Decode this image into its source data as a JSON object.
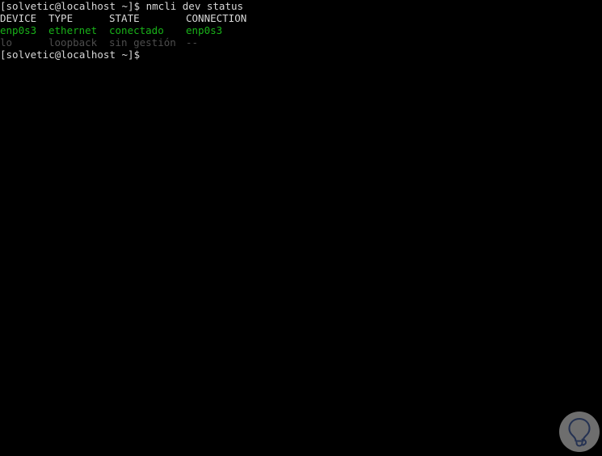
{
  "terminal": {
    "background_color": "#000000",
    "default_text_color": "#d8d8d8",
    "green_text_color": "#19b219",
    "dim_text_color": "#4d4d4d",
    "prompt": "[solvetic@localhost ~]$",
    "command_line": {
      "prompt": "[solvetic@localhost ~]$",
      "separator": " ",
      "command": "nmcli dev status"
    },
    "table": {
      "headers": {
        "device": "DEVICE",
        "type": "TYPE",
        "state": "STATE",
        "connection": "CONNECTION"
      },
      "rows": [
        {
          "device": "enp0s3",
          "type": "ethernet",
          "state": "conectado",
          "connection": "enp0s3",
          "color": "green"
        },
        {
          "device": "lo",
          "type": "loopback",
          "state": "sin gestión",
          "connection": "--",
          "color": "dim"
        }
      ]
    },
    "final_prompt": "[solvetic@localhost ~]$"
  },
  "watermark": {
    "icon": "lightbulb-icon",
    "circle_color": "#7e7e7e",
    "bulb_color": "#2b3a5e"
  }
}
